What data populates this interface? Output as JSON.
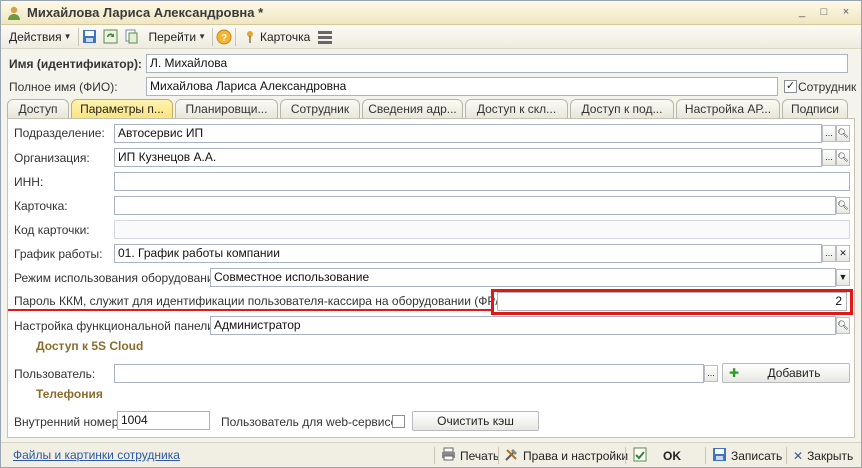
{
  "window": {
    "title": "Михайлова Лариса Александровна *",
    "controls": [
      "_",
      "□",
      "×"
    ]
  },
  "toolbar": {
    "actions_label": "Действия",
    "goto_label": "Перейти",
    "card_label": "Карточка",
    "help_glyph": "?"
  },
  "header_fields": {
    "name_label": "Имя (идентификатор):",
    "name_value": "Л. Михайлова",
    "fullname_label": "Полное имя (ФИО):",
    "fullname_value": "Михайлова Лариса Александровна",
    "employee_checkbox_label": "Сотрудник",
    "employee_checked": "✓"
  },
  "tabs": [
    {
      "label": "Доступ"
    },
    {
      "label": "Параметры п..."
    },
    {
      "label": "Планировщи..."
    },
    {
      "label": "Сотрудник"
    },
    {
      "label": "Сведения адр..."
    },
    {
      "label": "Доступ к скл..."
    },
    {
      "label": "Доступ к под..."
    },
    {
      "label": "Настройка АР..."
    },
    {
      "label": "Подписи"
    }
  ],
  "form": {
    "division_label": "Подразделение:",
    "division_value": "Автосервис ИП",
    "organization_label": "Организация:",
    "organization_value": "ИП Кузнецов А.А.",
    "inn_label": "ИНН:",
    "inn_value": "",
    "card_label": "Карточка:",
    "card_value": "",
    "card_code_label": "Код карточки:",
    "card_code_value": "",
    "schedule_label": "График работы:",
    "schedule_value": "01. График работы компании",
    "equipment_mode_label": "Режим использования оборудования:",
    "equipment_mode_value": "Совместное использование",
    "kkm_password_label": "Пароль ККМ, служит для идентификации пользователя-кассира на оборудовании (ФР/ККМ):",
    "kkm_password_value": "2",
    "panel_settings_label": "Настройка функциональной панели:",
    "panel_settings_value": "Администратор",
    "cloud_section": "Доступ к 5S Cloud",
    "user_label": "Пользователь:",
    "user_value": "",
    "add_button": "Добавить",
    "telephony_section": "Телефония",
    "internal_number_label": "Внутренний номер:",
    "internal_number_value": "1004",
    "webservice_label": "Пользователь для web-сервисов",
    "clear_cache_button": "Очистить кэш"
  },
  "bottom": {
    "files_link": "Файлы и картинки сотрудника",
    "print_label": "Печать",
    "rights_label": "Права и настройки",
    "ok_label": "OK",
    "save_label": "Записать",
    "close_label": "Закрыть"
  },
  "colors": {
    "highlight": "#e01818",
    "section_title": "#8a6d2d",
    "active_tab": "#f9e27b",
    "link": "#2c58a5"
  }
}
